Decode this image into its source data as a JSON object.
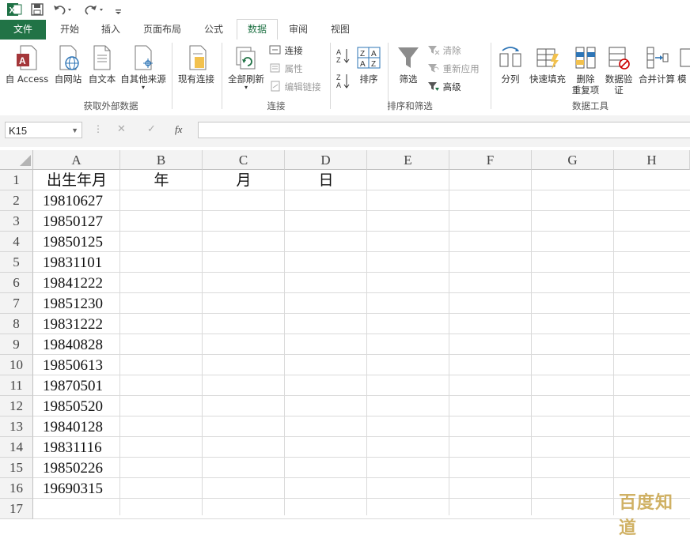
{
  "qat": {
    "app_icon": "excel-logo-icon",
    "save_icon": "save-icon",
    "undo_icon": "undo-icon",
    "redo_icon": "redo-icon",
    "customize_icon": "customize-qat-icon"
  },
  "tabs": [
    {
      "label": "文件"
    },
    {
      "label": "开始"
    },
    {
      "label": "插入"
    },
    {
      "label": "页面布局"
    },
    {
      "label": "公式"
    },
    {
      "label": "数据"
    },
    {
      "label": "审阅"
    },
    {
      "label": "视图"
    }
  ],
  "ribbon": {
    "get_external": {
      "from_access": "自 Access",
      "from_web": "自网站",
      "from_text": "自文本",
      "from_other": "自其他来源",
      "existing_conn": "现有连接",
      "group_label": "获取外部数据"
    },
    "connections": {
      "refresh_all": "全部刷新",
      "connections": "连接",
      "properties": "属性",
      "edit_links": "编辑链接",
      "group_label": "连接"
    },
    "sort_filter": {
      "sort": "排序",
      "filter": "筛选",
      "clear": "清除",
      "reapply": "重新应用",
      "advanced": "高级",
      "group_label": "排序和筛选"
    },
    "data_tools": {
      "text_to_columns": "分列",
      "flash_fill": "快速填充",
      "remove_dup_1": "删除",
      "remove_dup_2": "重复项",
      "validation_1": "数据验",
      "validation_2": "证",
      "consolidate": "合并计算",
      "whatif": "模",
      "group_label": "数据工具"
    }
  },
  "formula_bar": {
    "name_box": "K15",
    "cancel": "✕",
    "enter": "✓",
    "fx": "fx",
    "value": ""
  },
  "grid": {
    "columns": [
      "A",
      "B",
      "C",
      "D",
      "E",
      "F",
      "G",
      "H"
    ],
    "rows": [
      "1",
      "2",
      "3",
      "4",
      "5",
      "6",
      "7",
      "8",
      "9",
      "10",
      "11",
      "12",
      "13",
      "14",
      "15",
      "16",
      "17"
    ],
    "header_row": {
      "A": "出生年月",
      "B": "年",
      "C": "月",
      "D": "日"
    },
    "col_a_values": [
      "19810627",
      "19850127",
      "19850125",
      "19831101",
      "19841222",
      "19851230",
      "19831222",
      "19840828",
      "19850613",
      "19870501",
      "19850520",
      "19840128",
      "19831116",
      "19850226",
      "19690315"
    ]
  },
  "watermark": "百度知道",
  "colors": {
    "accent": "#217346"
  }
}
